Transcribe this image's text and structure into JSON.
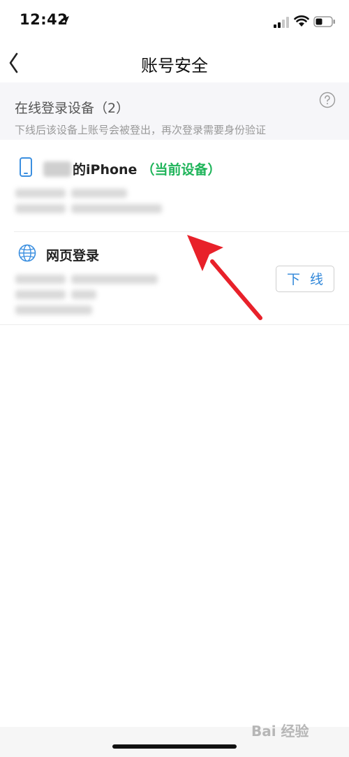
{
  "status_bar": {
    "time": "12:42"
  },
  "nav": {
    "title": "账号安全"
  },
  "section": {
    "title": "在线登录设备（2）",
    "subtitle": "下线后该设备上账号会被登出，再次登录需要身份验证"
  },
  "devices": [
    {
      "name_suffix": "的iPhone",
      "tag": "（当前设备）",
      "icon": "phone-icon"
    },
    {
      "name": "网页登录",
      "icon": "globe-icon",
      "action_label": "下 线"
    }
  ],
  "watermark": "Bai 经验",
  "colors": {
    "accent_blue": "#2f86d9",
    "current_green": "#1fb45a",
    "arrow_red": "#e8212a",
    "section_bg": "#f6f6f9"
  }
}
